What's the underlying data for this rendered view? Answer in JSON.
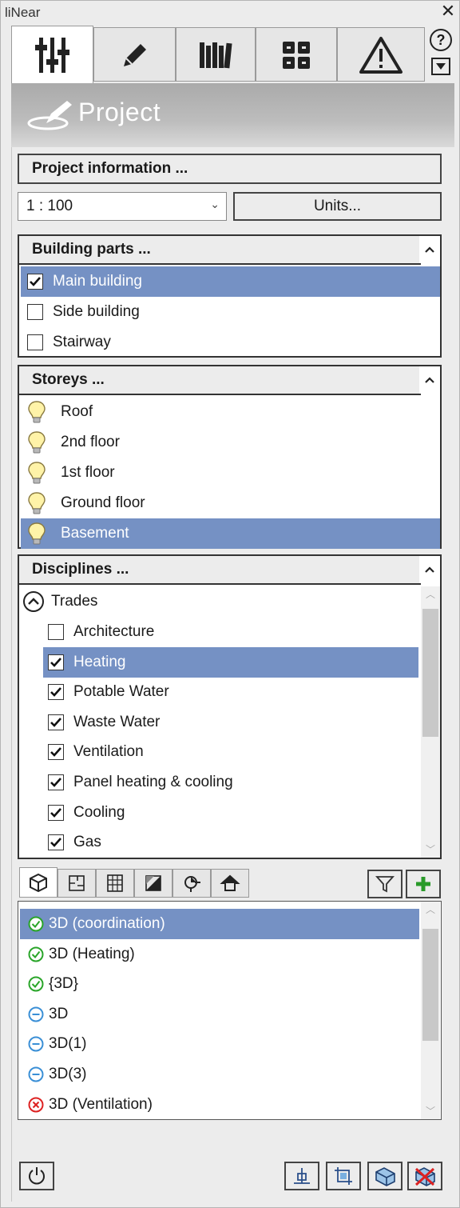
{
  "window": {
    "title": "liNear",
    "close_icon": "close-icon"
  },
  "tabs": [
    {
      "name": "project",
      "icon": "sliders-icon",
      "active": true
    },
    {
      "name": "edit",
      "icon": "pencil-icon",
      "active": false
    },
    {
      "name": "library",
      "icon": "books-icon",
      "active": false
    },
    {
      "name": "apps",
      "icon": "grid-icon",
      "active": false
    },
    {
      "name": "warnings",
      "icon": "warning-icon",
      "active": false
    }
  ],
  "panel": {
    "title": "Project",
    "project_info_label": "Project information ...",
    "scale": {
      "value": "1 : 100"
    },
    "units_label": "Units..."
  },
  "building_parts": {
    "title": "Building parts ...",
    "items": [
      {
        "label": "Main building",
        "checked": true,
        "selected": true
      },
      {
        "label": "Side building",
        "checked": false,
        "selected": false
      },
      {
        "label": "Stairway",
        "checked": false,
        "selected": false
      }
    ]
  },
  "storeys": {
    "title": "Storeys ...",
    "items": [
      {
        "label": "Roof",
        "selected": false
      },
      {
        "label": "2nd floor",
        "selected": false
      },
      {
        "label": "1st floor",
        "selected": false
      },
      {
        "label": "Ground floor",
        "selected": false
      },
      {
        "label": "Basement",
        "selected": true
      }
    ]
  },
  "disciplines": {
    "title": "Disciplines ...",
    "group_label": "Trades",
    "items": [
      {
        "label": "Architecture",
        "checked": false,
        "selected": false
      },
      {
        "label": "Heating",
        "checked": true,
        "selected": true
      },
      {
        "label": "Potable Water",
        "checked": true,
        "selected": false
      },
      {
        "label": "Waste Water",
        "checked": true,
        "selected": false
      },
      {
        "label": "Ventilation",
        "checked": true,
        "selected": false
      },
      {
        "label": "Panel heating & cooling",
        "checked": true,
        "selected": false
      },
      {
        "label": "Cooling",
        "checked": true,
        "selected": false
      },
      {
        "label": "Gas",
        "checked": true,
        "selected": false
      }
    ]
  },
  "views": {
    "items": [
      {
        "label": "3D (coordination)",
        "status": "ok",
        "selected": true
      },
      {
        "label": "3D (Heating)",
        "status": "ok",
        "selected": false
      },
      {
        "label": "{3D}",
        "status": "ok",
        "selected": false
      },
      {
        "label": "3D",
        "status": "minus",
        "selected": false
      },
      {
        "label": "3D(1)",
        "status": "minus",
        "selected": false
      },
      {
        "label": "3D(3)",
        "status": "minus",
        "selected": false
      },
      {
        "label": "3D (Ventilation)",
        "status": "error",
        "selected": false
      }
    ]
  },
  "colors": {
    "selection": "#7591c4",
    "ok": "#2aa52a",
    "minus": "#3a8fd6",
    "error": "#d22"
  }
}
